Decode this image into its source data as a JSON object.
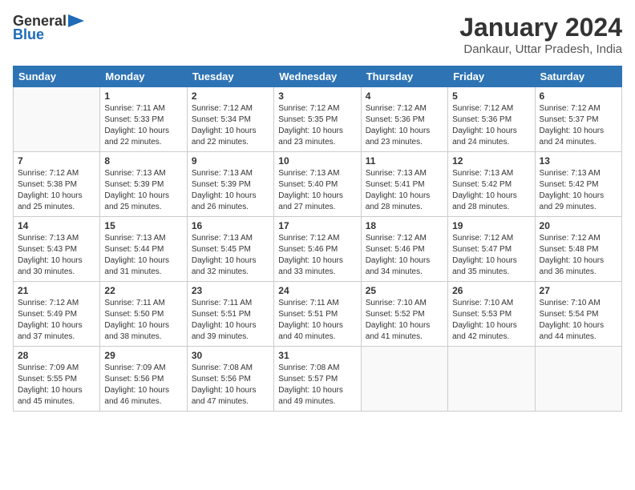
{
  "header": {
    "logo_general": "General",
    "logo_blue": "Blue",
    "month_title": "January 2024",
    "location": "Dankaur, Uttar Pradesh, India"
  },
  "days_of_week": [
    "Sunday",
    "Monday",
    "Tuesday",
    "Wednesday",
    "Thursday",
    "Friday",
    "Saturday"
  ],
  "weeks": [
    [
      {
        "day": "",
        "info": ""
      },
      {
        "day": "1",
        "info": "Sunrise: 7:11 AM\nSunset: 5:33 PM\nDaylight: 10 hours\nand 22 minutes."
      },
      {
        "day": "2",
        "info": "Sunrise: 7:12 AM\nSunset: 5:34 PM\nDaylight: 10 hours\nand 22 minutes."
      },
      {
        "day": "3",
        "info": "Sunrise: 7:12 AM\nSunset: 5:35 PM\nDaylight: 10 hours\nand 23 minutes."
      },
      {
        "day": "4",
        "info": "Sunrise: 7:12 AM\nSunset: 5:36 PM\nDaylight: 10 hours\nand 23 minutes."
      },
      {
        "day": "5",
        "info": "Sunrise: 7:12 AM\nSunset: 5:36 PM\nDaylight: 10 hours\nand 24 minutes."
      },
      {
        "day": "6",
        "info": "Sunrise: 7:12 AM\nSunset: 5:37 PM\nDaylight: 10 hours\nand 24 minutes."
      }
    ],
    [
      {
        "day": "7",
        "info": "Sunrise: 7:12 AM\nSunset: 5:38 PM\nDaylight: 10 hours\nand 25 minutes."
      },
      {
        "day": "8",
        "info": "Sunrise: 7:13 AM\nSunset: 5:39 PM\nDaylight: 10 hours\nand 25 minutes."
      },
      {
        "day": "9",
        "info": "Sunrise: 7:13 AM\nSunset: 5:39 PM\nDaylight: 10 hours\nand 26 minutes."
      },
      {
        "day": "10",
        "info": "Sunrise: 7:13 AM\nSunset: 5:40 PM\nDaylight: 10 hours\nand 27 minutes."
      },
      {
        "day": "11",
        "info": "Sunrise: 7:13 AM\nSunset: 5:41 PM\nDaylight: 10 hours\nand 28 minutes."
      },
      {
        "day": "12",
        "info": "Sunrise: 7:13 AM\nSunset: 5:42 PM\nDaylight: 10 hours\nand 28 minutes."
      },
      {
        "day": "13",
        "info": "Sunrise: 7:13 AM\nSunset: 5:42 PM\nDaylight: 10 hours\nand 29 minutes."
      }
    ],
    [
      {
        "day": "14",
        "info": "Sunrise: 7:13 AM\nSunset: 5:43 PM\nDaylight: 10 hours\nand 30 minutes."
      },
      {
        "day": "15",
        "info": "Sunrise: 7:13 AM\nSunset: 5:44 PM\nDaylight: 10 hours\nand 31 minutes."
      },
      {
        "day": "16",
        "info": "Sunrise: 7:13 AM\nSunset: 5:45 PM\nDaylight: 10 hours\nand 32 minutes."
      },
      {
        "day": "17",
        "info": "Sunrise: 7:12 AM\nSunset: 5:46 PM\nDaylight: 10 hours\nand 33 minutes."
      },
      {
        "day": "18",
        "info": "Sunrise: 7:12 AM\nSunset: 5:46 PM\nDaylight: 10 hours\nand 34 minutes."
      },
      {
        "day": "19",
        "info": "Sunrise: 7:12 AM\nSunset: 5:47 PM\nDaylight: 10 hours\nand 35 minutes."
      },
      {
        "day": "20",
        "info": "Sunrise: 7:12 AM\nSunset: 5:48 PM\nDaylight: 10 hours\nand 36 minutes."
      }
    ],
    [
      {
        "day": "21",
        "info": "Sunrise: 7:12 AM\nSunset: 5:49 PM\nDaylight: 10 hours\nand 37 minutes."
      },
      {
        "day": "22",
        "info": "Sunrise: 7:11 AM\nSunset: 5:50 PM\nDaylight: 10 hours\nand 38 minutes."
      },
      {
        "day": "23",
        "info": "Sunrise: 7:11 AM\nSunset: 5:51 PM\nDaylight: 10 hours\nand 39 minutes."
      },
      {
        "day": "24",
        "info": "Sunrise: 7:11 AM\nSunset: 5:51 PM\nDaylight: 10 hours\nand 40 minutes."
      },
      {
        "day": "25",
        "info": "Sunrise: 7:10 AM\nSunset: 5:52 PM\nDaylight: 10 hours\nand 41 minutes."
      },
      {
        "day": "26",
        "info": "Sunrise: 7:10 AM\nSunset: 5:53 PM\nDaylight: 10 hours\nand 42 minutes."
      },
      {
        "day": "27",
        "info": "Sunrise: 7:10 AM\nSunset: 5:54 PM\nDaylight: 10 hours\nand 44 minutes."
      }
    ],
    [
      {
        "day": "28",
        "info": "Sunrise: 7:09 AM\nSunset: 5:55 PM\nDaylight: 10 hours\nand 45 minutes."
      },
      {
        "day": "29",
        "info": "Sunrise: 7:09 AM\nSunset: 5:56 PM\nDaylight: 10 hours\nand 46 minutes."
      },
      {
        "day": "30",
        "info": "Sunrise: 7:08 AM\nSunset: 5:56 PM\nDaylight: 10 hours\nand 47 minutes."
      },
      {
        "day": "31",
        "info": "Sunrise: 7:08 AM\nSunset: 5:57 PM\nDaylight: 10 hours\nand 49 minutes."
      },
      {
        "day": "",
        "info": ""
      },
      {
        "day": "",
        "info": ""
      },
      {
        "day": "",
        "info": ""
      }
    ]
  ]
}
